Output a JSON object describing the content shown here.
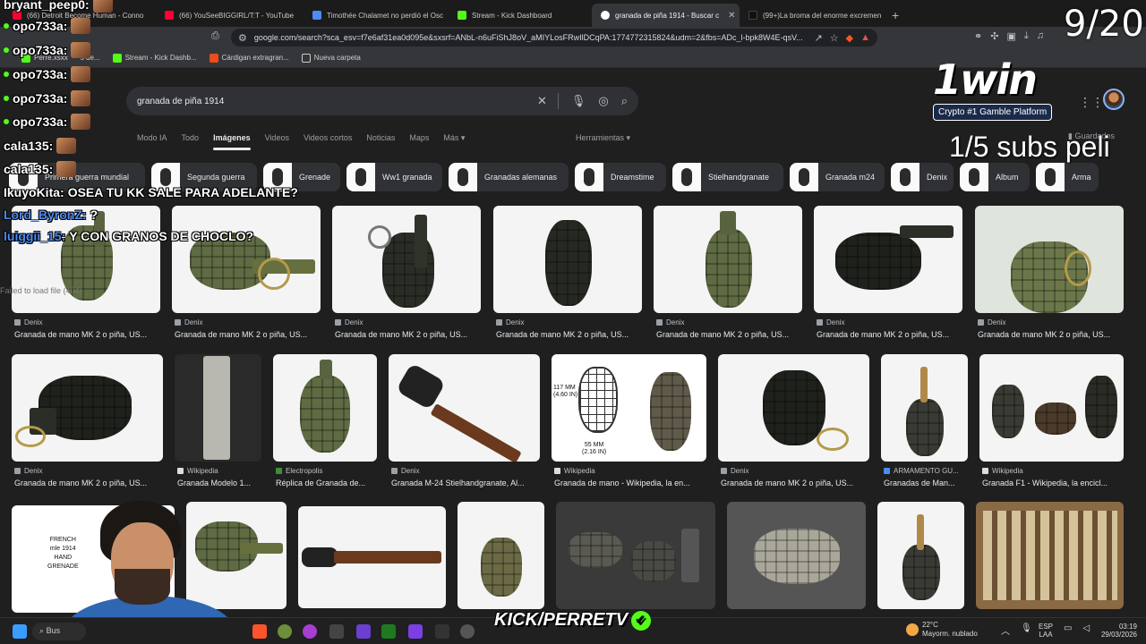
{
  "browser": {
    "tabs": [
      {
        "label": "(66) Detroit Become Human - Conno",
        "color": "#ff0033"
      },
      {
        "label": "(66) YouSeeBIGGIRL/T:T - YouTube",
        "color": "#ff0033"
      },
      {
        "label": "Timothée Chalamet no perdió el Osc",
        "color": "#4c8bf5"
      },
      {
        "label": "Stream - Kick Dashboard",
        "color": "#53fc18"
      },
      {
        "label": "granada de piña 1914 - Buscar c",
        "color": "#ffffff"
      },
      {
        "label": "(99+)La broma del enorme excremen",
        "color": "#111111"
      }
    ],
    "url": "google.com/search?sca_esv=f7e6af31ea0d095e&sxsrf=ANbL-n6uFiShJ8oV_aMIYLosFRwIlDCqPA:1774772315824&udm=2&fbs=ADc_l-bpk8W4E-qsV...",
    "bookmarks": [
      {
        "label": "Perre.xsxx",
        "color": "#53fc18"
      },
      {
        "label": "s de...",
        "color": "#888888"
      },
      {
        "label": "Stream - Kick Dashb...",
        "color": "#53fc18"
      },
      {
        "label": "Cárdigan extragran...",
        "color": "#e94e1b"
      },
      {
        "label": "Nueva carpeta",
        "color": "#cccccc"
      }
    ]
  },
  "google": {
    "query": "granada de piña 1914",
    "nav": [
      "Modo IA",
      "Todo",
      "Imágenes",
      "Videos",
      "Videos cortos",
      "Noticias",
      "Maps",
      "Más"
    ],
    "tools": "Herramientas",
    "saved": "Guardados",
    "chips": [
      "Primera guerra mundial",
      "Segunda guerra",
      "Grenade",
      "Ww1 granada",
      "Granadas alemanas",
      "Dreamstime",
      "Stielhandgranate",
      "Granada m24",
      "Denix",
      "Album",
      "Arma"
    ],
    "row1": [
      {
        "source": "Denix",
        "title": "Granada de mano MK 2 o piña, US..."
      },
      {
        "source": "Denix",
        "title": "Granada de mano MK 2 o piña, US..."
      },
      {
        "source": "Denix",
        "title": "Granada de mano MK 2 o piña, US..."
      },
      {
        "source": "Denix",
        "title": "Granada de mano MK 2 o piña, US..."
      },
      {
        "source": "Denix",
        "title": "Granada de mano MK 2 o piña, US..."
      },
      {
        "source": "Denix",
        "title": "Granada de mano MK 2 o piña, US..."
      },
      {
        "source": "Denix",
        "title": "Granada de mano MK 2 o piña, US..."
      }
    ],
    "row2": [
      {
        "source": "Denix",
        "title": "Granada de mano MK 2 o piña, US..."
      },
      {
        "source": "Wikipedia",
        "title": "Granada Modelo 1..."
      },
      {
        "source": "Electropolis",
        "title": "Réplica de Granada de..."
      },
      {
        "source": "Denix",
        "title": "Granada M-24 Stielhandgranate, Al..."
      },
      {
        "source": "Wikipedia",
        "title": "Granada de mano - Wikipedia, la en..."
      },
      {
        "source": "Denix",
        "title": "Granada de mano MK 2 o piña, US..."
      },
      {
        "source": "ARMAMENTO GU...",
        "title": "Granadas de Man..."
      },
      {
        "source": "Wikipedia",
        "title": "Granada F1 - Wikipedia, la encicl..."
      }
    ],
    "diagram": {
      "h1": "117 MM",
      "h2": "(4.60 IN)",
      "w1": "55 MM",
      "w2": "(2.16 IN)"
    },
    "french_card": [
      "FRENCH",
      "mle 1914",
      "HAND",
      "GRENADE"
    ]
  },
  "overlay": {
    "chat": [
      {
        "user": "bryant_peep0:",
        "msg": ""
      },
      {
        "user": "opo733a:",
        "msg": ""
      },
      {
        "user": "opo733a:",
        "msg": ""
      },
      {
        "user": "opo733a:",
        "msg": ""
      },
      {
        "user": "opo733a:",
        "msg": ""
      },
      {
        "user": "opo733a:",
        "msg": ""
      },
      {
        "user": "cala135:",
        "msg": ""
      },
      {
        "user": "cala135:",
        "msg": ""
      },
      {
        "user": "IkuyoKita:",
        "msg": "OSEA TU KK SALE PARA ADELANTE?"
      },
      {
        "user": "Lord_ByronZ:",
        "msg": "?"
      },
      {
        "user": "luiggii_15:",
        "msg": "Y CON GRANOS DE CHOCLO?"
      }
    ],
    "counter": "9/20",
    "sponsor": "1win",
    "sponsor_tag": "Crypto #1 Gamble Platform",
    "subs": "1/5 subs peli",
    "failed": "Failed to load file (404)",
    "channel": "KICK/PERRETV"
  },
  "taskbar": {
    "search": "Bus",
    "temp": "22°C",
    "weather": "Mayorm. nublado",
    "lang1": "ESP",
    "lang2": "LAA",
    "time": "03:19",
    "date": "29/03/2026"
  }
}
